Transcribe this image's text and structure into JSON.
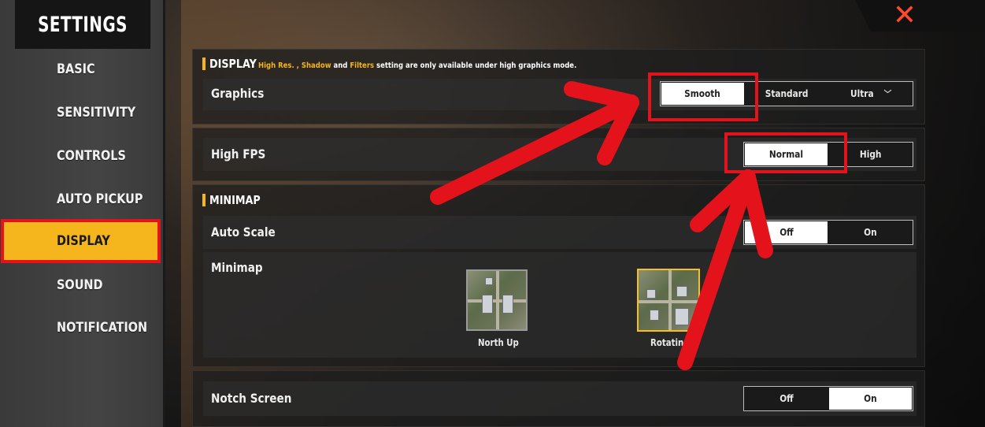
{
  "sidebar": {
    "title": "SETTINGS",
    "items": [
      {
        "label": "BASIC"
      },
      {
        "label": "SENSITIVITY"
      },
      {
        "label": "CONTROLS"
      },
      {
        "label": "AUTO PICKUP"
      },
      {
        "label": "DISPLAY"
      },
      {
        "label": "SOUND"
      },
      {
        "label": "NOTIFICATION"
      }
    ],
    "active": "DISPLAY"
  },
  "close": {
    "icon": "close-icon",
    "glyph": "✕"
  },
  "display": {
    "title": "DISPLAY",
    "note": {
      "part1": "High Res. , Shadow",
      "part2": " and ",
      "part3": "Filters",
      "part4": " setting are only available under high graphics mode."
    },
    "graphics": {
      "label": "Graphics",
      "options": [
        "Smooth",
        "Standard",
        "Ultra"
      ],
      "selected": "Smooth"
    },
    "high_fps": {
      "label": "High FPS",
      "options": [
        "Normal",
        "High"
      ],
      "selected": "Normal"
    }
  },
  "minimap": {
    "title": "MINIMAP",
    "auto_scale": {
      "label": "Auto Scale",
      "options": [
        "Off",
        "On"
      ],
      "selected": "Off"
    },
    "minimap": {
      "label": "Minimap",
      "options": [
        {
          "label": "North Up"
        },
        {
          "label": "Rotatin"
        }
      ],
      "selected": "Rotatin"
    }
  },
  "notch": {
    "label": "Notch Screen",
    "options": [
      "Off",
      "On"
    ],
    "selected": "On"
  },
  "colors": {
    "accent": "#f5b51c",
    "annotation_red": "#e4121a",
    "selected_option": "#ffffff"
  }
}
